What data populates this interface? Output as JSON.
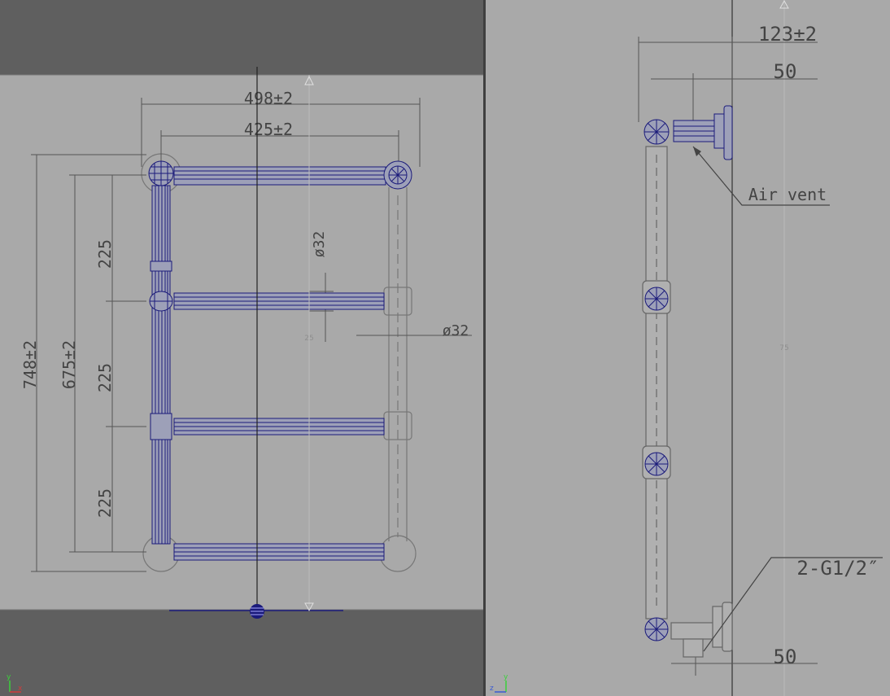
{
  "colors": {
    "viewport_bg": "#5f5f5f",
    "image_plane_bg": "#a9a9a9",
    "drawing_lines": "#5a5a5a",
    "wireframe": "#1a1a7a",
    "splitter": "#3f3f3f"
  },
  "front_view": {
    "overall_width": "498±2",
    "inner_width": "425±2",
    "overall_height": "748±2",
    "inner_height": "675±2",
    "spacing_top": "225",
    "spacing_mid": "225",
    "spacing_bottom": "225",
    "rail_diameter": "ø32",
    "tube_diameter": "ø32",
    "center_mark": "25"
  },
  "side_view": {
    "depth": "123±2",
    "offset_top": "50",
    "offset_bottom": "50",
    "air_vent_label": "Air vent",
    "connection_label": "2-G1/2″",
    "center_mark": "75"
  },
  "axes": {
    "y": "y",
    "x": "x",
    "z": "z"
  }
}
